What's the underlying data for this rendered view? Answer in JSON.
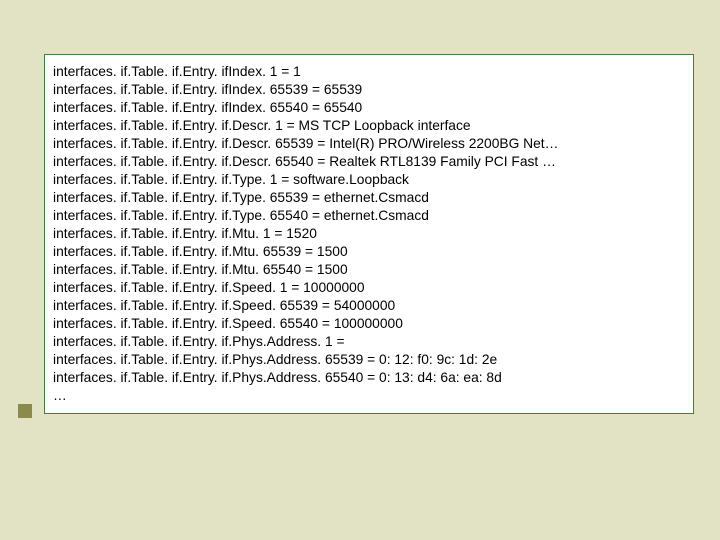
{
  "lines": [
    "interfaces. if.Table. if.Entry. ifIndex. 1 = 1",
    "interfaces. if.Table. if.Entry. ifIndex. 65539 = 65539",
    "interfaces. if.Table. if.Entry. ifIndex. 65540 = 65540",
    "interfaces. if.Table. if.Entry. if.Descr. 1 = MS TCP Loopback interface",
    "interfaces. if.Table. if.Entry. if.Descr. 65539 = Intel(R) PRO/Wireless 2200BG Net…",
    "interfaces. if.Table. if.Entry. if.Descr. 65540 = Realtek RTL8139 Family PCI Fast …",
    "interfaces. if.Table. if.Entry. if.Type. 1 = software.Loopback",
    "interfaces. if.Table. if.Entry. if.Type. 65539 = ethernet.Csmacd",
    "interfaces. if.Table. if.Entry. if.Type. 65540 = ethernet.Csmacd",
    "interfaces. if.Table. if.Entry. if.Mtu. 1 = 1520",
    "interfaces. if.Table. if.Entry. if.Mtu. 65539 = 1500",
    "interfaces. if.Table. if.Entry. if.Mtu. 65540 = 1500",
    "interfaces. if.Table. if.Entry. if.Speed. 1 = 10000000",
    "interfaces. if.Table. if.Entry. if.Speed. 65539 = 54000000",
    "interfaces. if.Table. if.Entry. if.Speed. 65540 = 100000000",
    "interfaces. if.Table. if.Entry. if.Phys.Address. 1 =",
    "interfaces. if.Table. if.Entry. if.Phys.Address. 65539 = 0: 12: f0: 9c: 1d: 2e",
    "interfaces. if.Table. if.Entry. if.Phys.Address. 65540 = 0: 13: d4: 6a: ea: 8d",
    "…"
  ]
}
